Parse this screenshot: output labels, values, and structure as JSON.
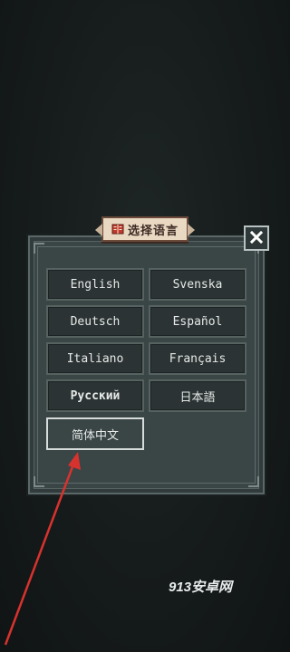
{
  "dialog": {
    "title": "选择语言",
    "close_label": "✕"
  },
  "languages": [
    {
      "label": "English",
      "selected": false
    },
    {
      "label": "Svenska",
      "selected": false
    },
    {
      "label": "Deutsch",
      "selected": false
    },
    {
      "label": "Español",
      "selected": false
    },
    {
      "label": "Italiano",
      "selected": false
    },
    {
      "label": "Français",
      "selected": false
    },
    {
      "label": "Русский",
      "selected": false
    },
    {
      "label": "日本語",
      "selected": false
    },
    {
      "label": "简体中文",
      "selected": true
    }
  ],
  "watermark": "913安卓网",
  "colors": {
    "annotation_arrow": "#d8322e",
    "ribbon": "#e9d8c2",
    "panel": "#3a4546"
  }
}
